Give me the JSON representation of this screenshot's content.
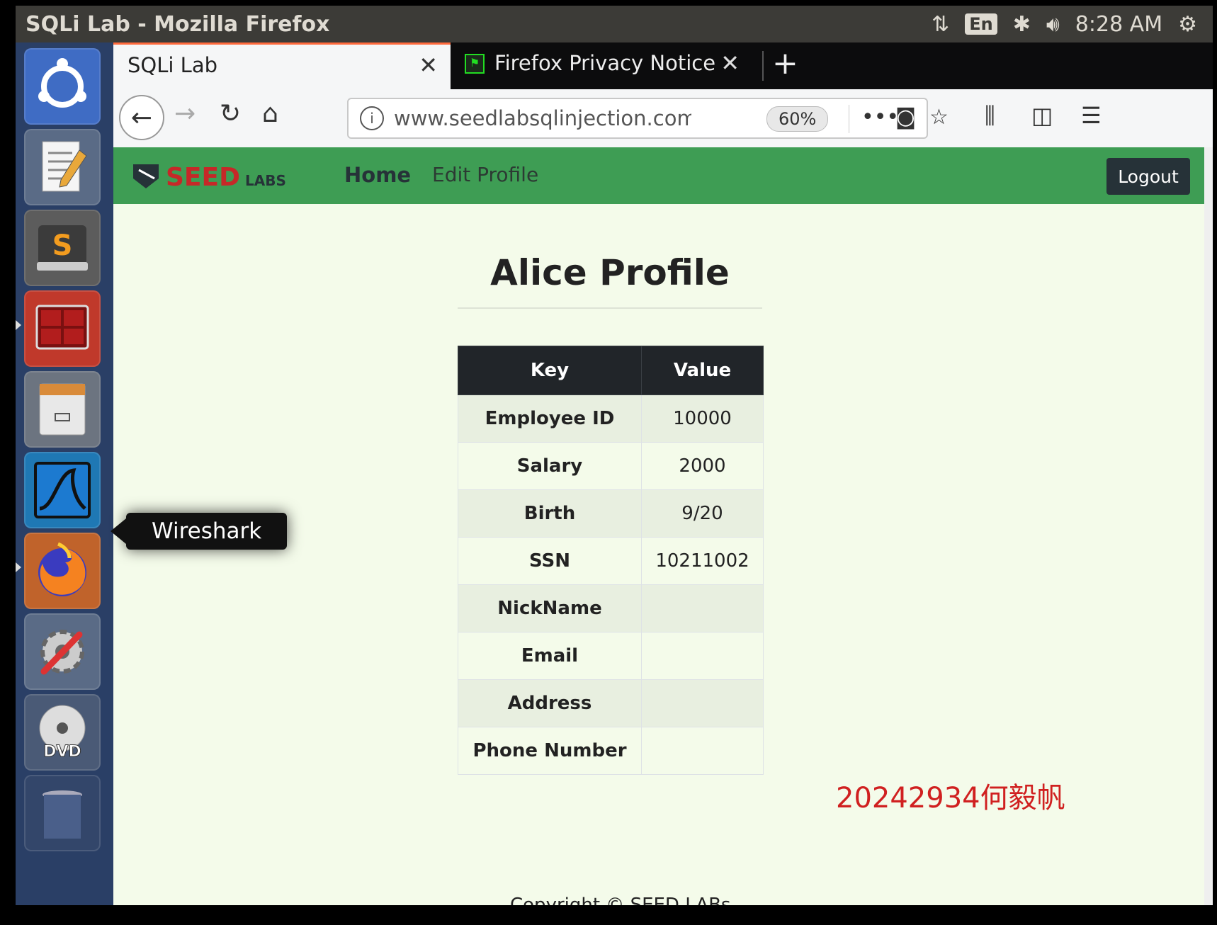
{
  "window": {
    "title": "SQLi Lab - Mozilla Firefox"
  },
  "tray": {
    "input_method": "En",
    "time": "8:28 AM"
  },
  "launcher": {
    "items": [
      "ubuntu-dash",
      "text-editor",
      "sublime-text",
      "terminal",
      "file-manager",
      "wireshark",
      "firefox",
      "system-settings",
      "dvd",
      "trash"
    ],
    "tooltip": "Wireshark"
  },
  "browser": {
    "tabs": [
      {
        "label": "SQLi Lab",
        "active": true
      },
      {
        "label": "Firefox Privacy Notice — ",
        "active": false
      }
    ],
    "url": "www.seedlabsqlinjection.com",
    "zoom": "60%"
  },
  "site": {
    "logo": "SEEDLABS",
    "nav": {
      "home": "Home",
      "edit_profile": "Edit Profile",
      "logout": "Logout"
    },
    "profile_title": "Alice Profile",
    "table": {
      "headers": [
        "Key",
        "Value"
      ],
      "rows": [
        {
          "key": "Employee ID",
          "value": "10000"
        },
        {
          "key": "Salary",
          "value": "2000"
        },
        {
          "key": "Birth",
          "value": "9/20"
        },
        {
          "key": "SSN",
          "value": "10211002"
        },
        {
          "key": "NickName",
          "value": ""
        },
        {
          "key": "Email",
          "value": ""
        },
        {
          "key": "Address",
          "value": ""
        },
        {
          "key": "Phone Number",
          "value": ""
        }
      ]
    },
    "footer": "Copyright © SEED LABs"
  },
  "overlay": {
    "watermark": "20242934何毅帆"
  },
  "colors": {
    "navbar": "#3e9d54",
    "page_bg": "#f4fbea",
    "table_header": "#212529",
    "watermark": "#d02020"
  }
}
